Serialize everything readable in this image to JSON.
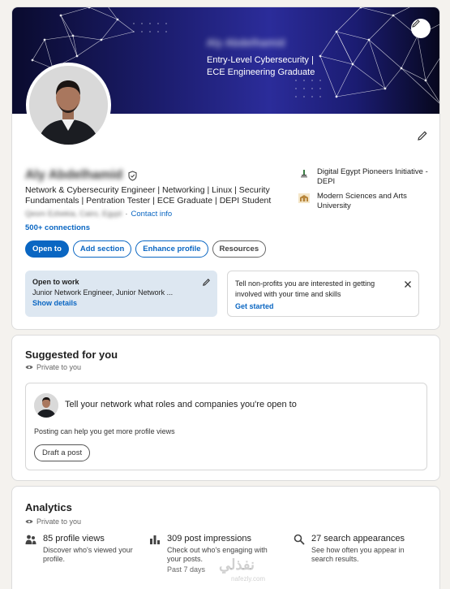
{
  "profile": {
    "banner_name": "Aly Abdelhamid",
    "banner_tagline_1": "Entry-Level Cybersecurity |",
    "banner_tagline_2": "ECE Engineering Graduate",
    "name": "Aly Abdelhamid",
    "headline": "Network & Cybersecurity Engineer | Networking | Linux | Security Fundamentals | Pentration Tester | ECE Graduate | DEPI Student",
    "location": "Qesm Ezbekia, Cairo, Egypt",
    "location_sep": "·",
    "contact_info": "Contact info",
    "connections": "500+ connections",
    "buttons": {
      "open_to": "Open to",
      "add_section": "Add section",
      "enhance_profile": "Enhance profile",
      "resources": "Resources"
    },
    "education": [
      {
        "name": "Digital Egypt Pioneers Initiative - DEPI",
        "logo": "depi-logo"
      },
      {
        "name": "Modern Sciences and Arts University",
        "logo": "msa-logo"
      }
    ],
    "open_to_work": {
      "title": "Open to work",
      "roles": "Junior Network Engineer, Junior Network ...",
      "link": "Show details"
    },
    "nonprofit": {
      "text": "Tell non-profits you are interested in getting involved with your time and skills",
      "link": "Get started"
    }
  },
  "suggested": {
    "title": "Suggested for you",
    "privacy": "Private to you",
    "prompt": "Tell your network what roles and companies you're open to",
    "hint": "Posting can help you get more profile views",
    "button": "Draft a post"
  },
  "analytics": {
    "title": "Analytics",
    "privacy": "Private to you",
    "metrics": [
      {
        "title": "85 profile views",
        "desc": "Discover who's viewed your profile.",
        "extra": "",
        "icon": "people-icon"
      },
      {
        "title": "309 post impressions",
        "desc": "Check out who's engaging with your posts.",
        "extra": "Past 7 days",
        "icon": "bar-chart-icon"
      },
      {
        "title": "27 search appearances",
        "desc": "See how often you appear in search results.",
        "extra": "",
        "icon": "search-icon"
      }
    ]
  },
  "watermark": {
    "text": "نفذلي",
    "sub": "nafezly.com"
  },
  "colors": {
    "accent": "#0a66c2",
    "open_to_work_bg": "#dde7f1",
    "page_bg": "#f4f2ee"
  }
}
